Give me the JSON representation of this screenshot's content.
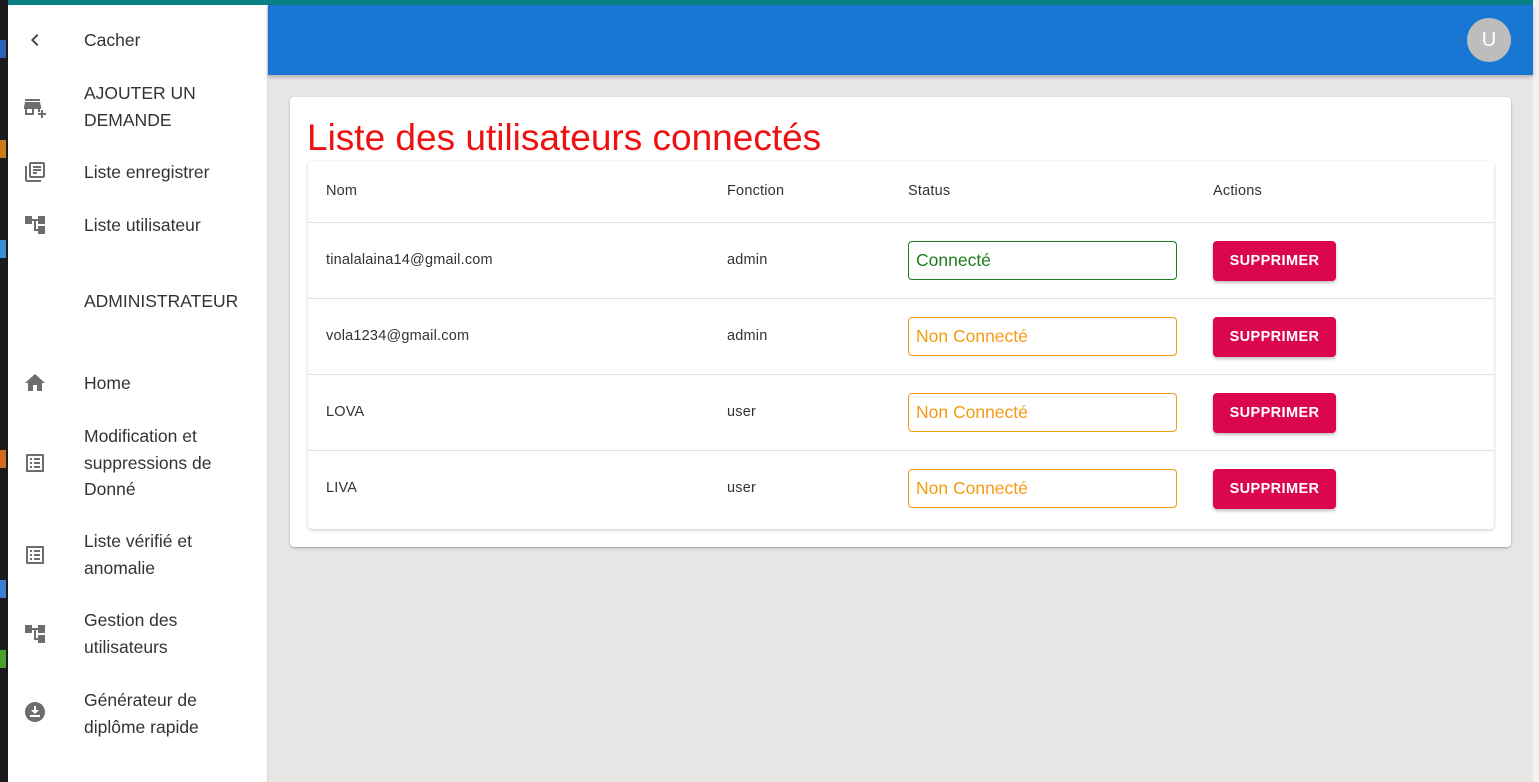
{
  "sidebar": {
    "items": [
      {
        "label": "Cacher",
        "icon": "chevron-left-icon"
      },
      {
        "label": "AJOUTER UN DEMANDE",
        "icon": "add-business-icon"
      },
      {
        "label": "Liste enregistrer",
        "icon": "library-books-icon"
      },
      {
        "label": "Liste utilisateur",
        "icon": "account-tree-icon"
      }
    ],
    "section_label": "ADMINISTRATEUR",
    "admin_items": [
      {
        "label": "Home",
        "icon": "home-icon"
      },
      {
        "label": "Modification et suppressions de Donné",
        "icon": "list-alt-icon"
      },
      {
        "label": "Liste vérifié et anomalie",
        "icon": "list-alt-icon"
      },
      {
        "label": "Gestion des utilisateurs",
        "icon": "account-tree-icon"
      },
      {
        "label": "Générateur de diplôme rapide",
        "icon": "download-circle-icon"
      }
    ]
  },
  "header": {
    "avatar_letter": "U",
    "color": "#1976d2"
  },
  "main": {
    "title": "Liste des utilisateurs connectés",
    "title_color": "#ee1111",
    "table": {
      "headers": [
        "Nom",
        "Fonction",
        "Status",
        "Actions"
      ],
      "rows": [
        {
          "nom": "tinalalaina14@gmail.com",
          "fonction": "admin",
          "status": "Connecté",
          "action": "SUPPRIMER"
        },
        {
          "nom": "vola1234@gmail.com",
          "fonction": "admin",
          "status": "Non Connecté",
          "action": "SUPPRIMER"
        },
        {
          "nom": "LOVA",
          "fonction": "user",
          "status": "Non Connecté",
          "action": "SUPPRIMER"
        },
        {
          "nom": "LIVA",
          "fonction": "user",
          "status": "Non Connecté",
          "action": "SUPPRIMER"
        }
      ]
    },
    "colors": {
      "connected": "#1e7d1e",
      "not_connected": "#f39c12",
      "delete_button": "#dc0550"
    }
  }
}
